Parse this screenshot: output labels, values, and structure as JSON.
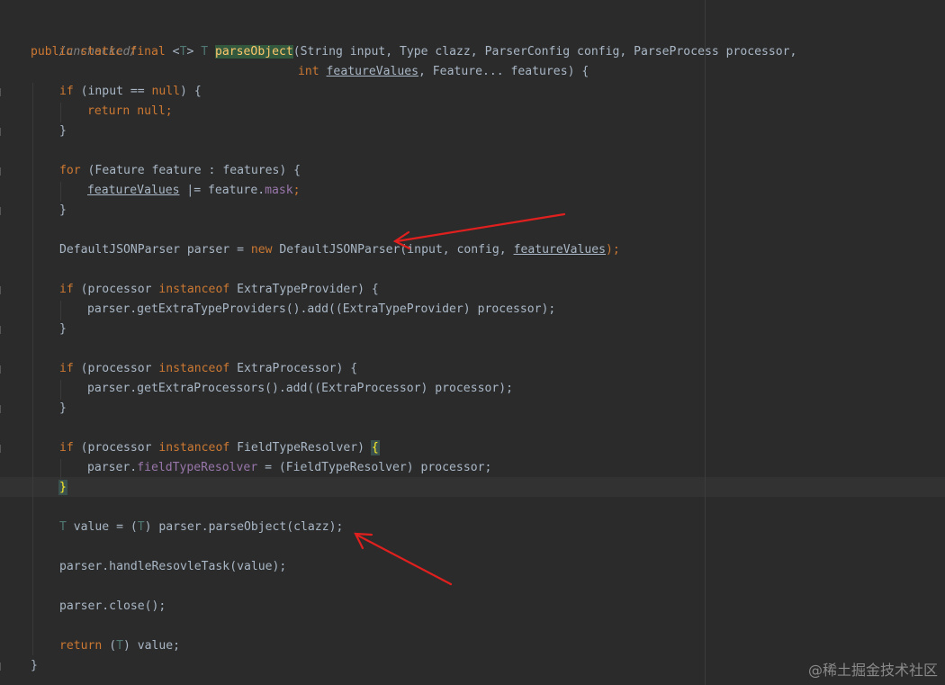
{
  "colors": {
    "background": "#2b2b2b",
    "keyword": "#cc7832",
    "identifier": "#a9b7c6",
    "method": "#ffc66d",
    "type_param": "#507874",
    "field": "#9876aa",
    "annotation_arrow": "#e0201e"
  },
  "comment": "/unchecked/",
  "code": {
    "sig1_kw": "public static final ",
    "sig1_lt": "<",
    "sig1_T1": "T",
    "sig1_gt": "> ",
    "sig1_T2": "T",
    "sig1_sp": " ",
    "sig1_method": "parseObject",
    "sig1_args": "(String input, Type clazz, ParserConfig config, ParseProcess processor,",
    "sig2_int": "int ",
    "sig2_fv": "featureValues",
    "sig2_rest": ", Feature... features) {",
    "l3_if": "if ",
    "l3_a": "(input == ",
    "l3_null": "null",
    "l3_b": ") {",
    "l4_return": "return ",
    "l4_null": "null",
    "l4_semi": ";",
    "close_brace": "}",
    "l6_for": "for ",
    "l6_rest": "(Feature feature : features) {",
    "l7_fv": "featureValues",
    "l7_mid": " |= feature.",
    "l7_mask": "mask",
    "l7_semi": ";",
    "l9_a": "DefaultJSONParser parser = ",
    "l9_new": "new ",
    "l9_b": "DefaultJSONParser(input, config, ",
    "l9_fv": "featureValues",
    "l9_c": ");",
    "l10_if": "if ",
    "l10_a": "(processor ",
    "l10_inst": "instanceof ",
    "l10_b": "ExtraTypeProvider) {",
    "l11": "parser.getExtraTypeProviders().add((ExtraTypeProvider) processor);",
    "l13_if": "if ",
    "l13_a": "(processor ",
    "l13_inst": "instanceof ",
    "l13_b": "ExtraProcessor) {",
    "l14": "parser.getExtraProcessors().add((ExtraProcessor) processor);",
    "l16_if": "if ",
    "l16_a": "(processor ",
    "l16_inst": "instanceof ",
    "l16_b": "FieldTypeResolver) ",
    "l16_brace": "{",
    "l17_a": "parser.",
    "l17_field": "fieldTypeResolver",
    "l17_b": " = (FieldTypeResolver) processor;",
    "l18_brace": "}",
    "l19_T": "T",
    "l19_a": " value = (",
    "l19_T2": "T",
    "l19_b": ") parser.parseObject(clazz);",
    "l20": "parser.handleResovleTask(value);",
    "l21": "parser.close();",
    "l22_return": "return ",
    "l22_a": "(",
    "l22_T": "T",
    "l22_b": ") value;",
    "last_brace": "}"
  },
  "watermark": "@稀土掘金技术社区"
}
